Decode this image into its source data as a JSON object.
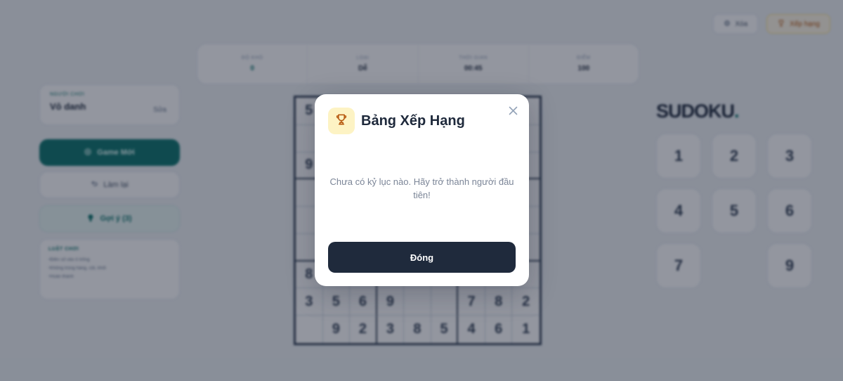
{
  "topbar": {
    "settings_label": "Xóa",
    "rank_label": "Xếp hạng"
  },
  "stats": [
    {
      "label": "ĐỘ KHÓ",
      "value": "0"
    },
    {
      "label": "LOẠI",
      "value": "Dễ"
    },
    {
      "label": "THỜI GIAN",
      "value": "00:45"
    },
    {
      "label": "ĐIỂM",
      "value": "100"
    }
  ],
  "player": {
    "label": "NGƯỜI CHƠI",
    "name": "Vô danh",
    "edit_label": "Sửa"
  },
  "actions": {
    "new_game": "Game Mới",
    "undo": "Làm lại",
    "hint": "Gợi ý (3)"
  },
  "guide": {
    "title": "LUẬT CHƠI",
    "items": [
      "Điền số vào ô trống",
      "Không trùng hàng, cột, khối",
      "Hoàn thành"
    ]
  },
  "board": {
    "cells": [
      "5",
      "",
      "",
      "",
      "",
      "",
      "",
      "",
      "",
      "",
      "",
      "",
      "",
      "",
      "",
      "",
      "",
      "",
      "9",
      "",
      "",
      "",
      "",
      "",
      "",
      "",
      "",
      "",
      "",
      "",
      "",
      "",
      "",
      "",
      "",
      "",
      "",
      "",
      "",
      "",
      "",
      "",
      "",
      "",
      "",
      "",
      "",
      "",
      "",
      "",
      "",
      "",
      "",
      "",
      "8",
      "",
      "",
      "",
      "",
      "",
      "",
      "",
      "",
      "3",
      "5",
      "6",
      "9",
      "",
      "",
      "7",
      "8",
      "2",
      "",
      "9",
      "2",
      "3",
      "8",
      "5",
      "4",
      "6",
      "1"
    ]
  },
  "brand": {
    "name": "SUDOKU",
    "dot": ".",
    "accent_color": "#0f766e"
  },
  "keypad": [
    "1",
    "2",
    "3",
    "4",
    "5",
    "6",
    "7",
    "",
    "9"
  ],
  "modal": {
    "icon": "trophy-icon",
    "title": "Bảng Xếp Hạng",
    "empty_message": "Chưa có kỷ lục nào. Hãy trở thành người đầu tiên!",
    "close_button_label": "Đóng",
    "button_color": "#1f2a3c",
    "icon_bg_color": "#fdf3c4"
  }
}
